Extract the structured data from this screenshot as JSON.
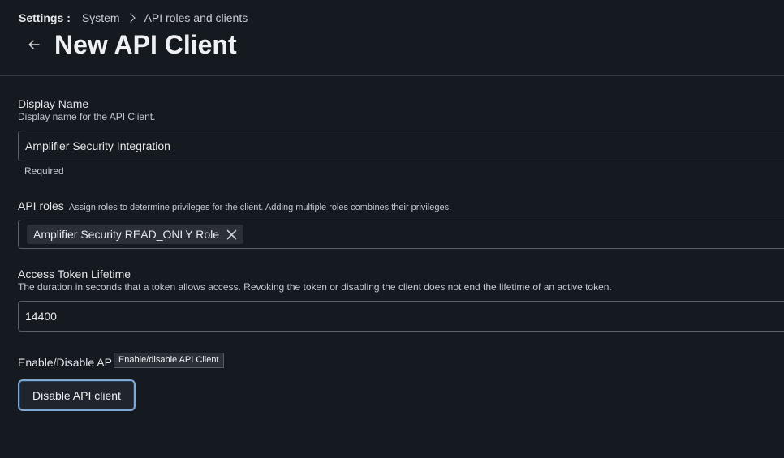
{
  "breadcrumb": {
    "root": "Settings",
    "separator": ":",
    "items": [
      "System",
      "API roles and clients"
    ]
  },
  "header": {
    "title": "New API Client",
    "back_icon": "arrow-left-icon"
  },
  "form": {
    "display_name": {
      "label": "Display Name",
      "description": "Display name for the API Client.",
      "value": "Amplifier Security Integration",
      "hint": "Required"
    },
    "api_roles": {
      "label": "API roles",
      "description": "Assign roles to determine privileges for the client. Adding multiple roles combines their privileges.",
      "selected": [
        "Amplifier Security READ_ONLY Role"
      ],
      "remove_icon": "close-icon"
    },
    "token_lifetime": {
      "label": "Access Token Lifetime",
      "description": "The duration in seconds that a token allows access. Revoking the token or disabling the client does not end the lifetime of an active token.",
      "value": "14400"
    },
    "enable_disable": {
      "label": "Enable/Disable AP",
      "tooltip": "Enable/disable API Client",
      "button_label": "Disable API client"
    }
  },
  "colors": {
    "background": "#151920",
    "focus_ring": "#7ea8d6"
  }
}
